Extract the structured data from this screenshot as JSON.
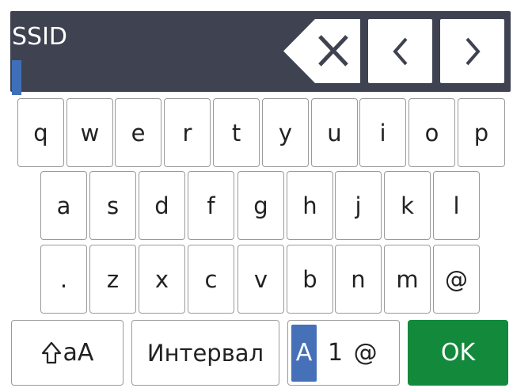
{
  "header": {
    "field_label": "SSID",
    "input_value": "",
    "icons": {
      "backspace": "backspace-icon",
      "left": "chevron-left-icon",
      "right": "chevron-right-icon"
    }
  },
  "keyboard": {
    "row1": [
      "q",
      "w",
      "e",
      "r",
      "t",
      "y",
      "u",
      "i",
      "o",
      "p"
    ],
    "row2": [
      "a",
      "s",
      "d",
      "f",
      "g",
      "h",
      "j",
      "k",
      "l"
    ],
    "row3": [
      ".",
      "z",
      "x",
      "c",
      "v",
      "b",
      "n",
      "m",
      "@"
    ],
    "shift_label": "aA",
    "space_label": "Интервал",
    "mode": {
      "active": "A",
      "rest": "1 @"
    },
    "ok_label": "OK"
  },
  "colors": {
    "header_bg": "#3f4250",
    "cursor": "#3f6fb8",
    "mode_active": "#4670b8",
    "ok": "#13893c"
  }
}
